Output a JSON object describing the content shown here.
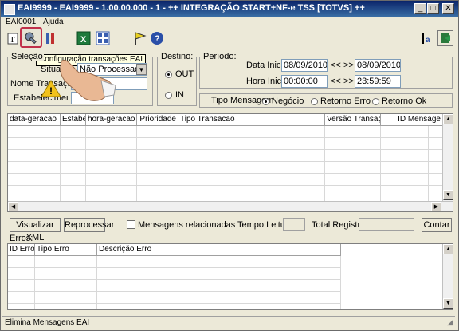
{
  "window": {
    "title": "EAI9999 - EAI9999 - 1.00.00.000 - 1 - ++ INTEGRAÇÃO START+NF-e TSS [TOTVS] ++"
  },
  "menu": {
    "file": "EAI0001",
    "help": "Ajuda"
  },
  "tooltip": "Configuração transações EAI",
  "selecao": {
    "legend": "Seleção",
    "situacao_value": "Não Processada",
    "situacao_label": "Situação",
    "nome_transacao_label": "Nome Transação",
    "estabelecimento_label": "Estabelecimento"
  },
  "destino": {
    "legend": "Destino:",
    "out": "OUT",
    "in": "IN"
  },
  "periodo": {
    "legend": "Período:",
    "data_inicial_label": "Data Inicial:",
    "data_inicial": "08/09/2010",
    "data_final": "08/09/2010",
    "hora_inicial_label": "Hora Inicial:",
    "hora_inicial": "00:00:00",
    "hora_final": "23:59:59",
    "arrow_left": "<<",
    "arrow_right": ">>"
  },
  "tipo_mensagem": {
    "label": "Tipo Mensagem",
    "negocio": "Negócio",
    "retorno_erro": "Retorno Erro",
    "retorno_ok": "Retorno Ok"
  },
  "main_grid": {
    "columns": [
      "data-geracao",
      "Estabelec",
      "hora-geracao",
      "Prioridade",
      "Tipo Transacao",
      "Versão Transação",
      "ID Mensage"
    ]
  },
  "actions": {
    "visualizar_xml": "Visualizar XML",
    "reprocessar": "Reprocessar",
    "mensagens_relacionadas": "Mensagens relacionadas",
    "tempo_leitura": "Tempo Leitura:",
    "total_registros": "Total Registros:",
    "contar": "Contar"
  },
  "erros": {
    "label": "Erros:",
    "columns": [
      "ID Erro",
      "Tipo Erro",
      "Descrição Erro"
    ]
  },
  "status": {
    "text": "Elimina Mensagens EAI"
  }
}
